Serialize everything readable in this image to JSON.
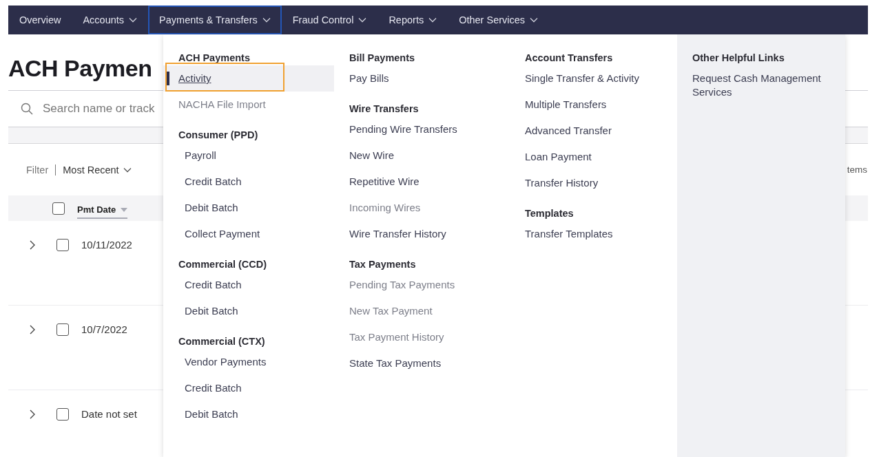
{
  "nav": [
    {
      "label": "Overview",
      "dropdown": false,
      "selected": false
    },
    {
      "label": "Accounts",
      "dropdown": true,
      "selected": false
    },
    {
      "label": "Payments & Transfers",
      "dropdown": true,
      "selected": true
    },
    {
      "label": "Fraud Control",
      "dropdown": true,
      "selected": false
    },
    {
      "label": "Reports",
      "dropdown": true,
      "selected": false
    },
    {
      "label": "Other Services",
      "dropdown": true,
      "selected": false
    }
  ],
  "page": {
    "title": "ACH Paymen",
    "search": {
      "placeholder": "Search name or track"
    },
    "filter": {
      "label": "Filter",
      "sort": "Most Recent",
      "right_text": "tems"
    },
    "table": {
      "all_checked": false,
      "columns": [
        {
          "label": "Pmt Date",
          "sorted": true
        }
      ],
      "rows": [
        {
          "date": "10/11/2022",
          "checked": false,
          "expanded": false
        },
        {
          "date": "10/7/2022",
          "checked": false,
          "expanded": false
        },
        {
          "date": "Date not set",
          "checked": false,
          "expanded": false
        }
      ]
    }
  },
  "menu": {
    "columns": [
      {
        "shaded": false,
        "sections": [
          {
            "heading": "ACH Payments",
            "items": [
              {
                "label": "Activity",
                "selected": true,
                "annotated": true,
                "disabled": false,
                "indented": false
              },
              {
                "label": "NACHA File Import",
                "selected": false,
                "annotated": false,
                "disabled": true,
                "indented": false
              }
            ]
          },
          {
            "heading": "Consumer (PPD)",
            "items": [
              {
                "label": "Payroll",
                "selected": false,
                "annotated": false,
                "disabled": false,
                "indented": true
              },
              {
                "label": "Credit Batch",
                "selected": false,
                "annotated": false,
                "disabled": false,
                "indented": true
              },
              {
                "label": "Debit Batch",
                "selected": false,
                "annotated": false,
                "disabled": false,
                "indented": true
              },
              {
                "label": "Collect Payment",
                "selected": false,
                "annotated": false,
                "disabled": false,
                "indented": true
              }
            ]
          },
          {
            "heading": "Commercial (CCD)",
            "items": [
              {
                "label": "Credit Batch",
                "selected": false,
                "annotated": false,
                "disabled": false,
                "indented": true
              },
              {
                "label": "Debit Batch",
                "selected": false,
                "annotated": false,
                "disabled": false,
                "indented": true
              }
            ]
          },
          {
            "heading": "Commercial (CTX)",
            "items": [
              {
                "label": "Vendor Payments",
                "selected": false,
                "annotated": false,
                "disabled": false,
                "indented": true
              },
              {
                "label": "Credit Batch",
                "selected": false,
                "annotated": false,
                "disabled": false,
                "indented": true
              },
              {
                "label": "Debit Batch",
                "selected": false,
                "annotated": false,
                "disabled": false,
                "indented": true
              }
            ]
          }
        ]
      },
      {
        "shaded": false,
        "sections": [
          {
            "heading": "Bill Payments",
            "items": [
              {
                "label": "Pay Bills",
                "selected": false,
                "annotated": false,
                "disabled": false,
                "indented": false
              }
            ]
          },
          {
            "heading": "Wire Transfers",
            "items": [
              {
                "label": "Pending Wire Transfers",
                "selected": false,
                "annotated": false,
                "disabled": false,
                "indented": false
              },
              {
                "label": "New Wire",
                "selected": false,
                "annotated": false,
                "disabled": false,
                "indented": false
              },
              {
                "label": "Repetitive Wire",
                "selected": false,
                "annotated": false,
                "disabled": false,
                "indented": false
              },
              {
                "label": "Incoming Wires",
                "selected": false,
                "annotated": false,
                "disabled": true,
                "indented": false
              },
              {
                "label": "Wire Transfer History",
                "selected": false,
                "annotated": false,
                "disabled": false,
                "indented": false
              }
            ]
          },
          {
            "heading": "Tax Payments",
            "items": [
              {
                "label": "Pending Tax Payments",
                "selected": false,
                "annotated": false,
                "disabled": true,
                "indented": false
              },
              {
                "label": "New Tax Payment",
                "selected": false,
                "annotated": false,
                "disabled": true,
                "indented": false
              },
              {
                "label": "Tax Payment History",
                "selected": false,
                "annotated": false,
                "disabled": true,
                "indented": false
              },
              {
                "label": "State Tax Payments",
                "selected": false,
                "annotated": false,
                "disabled": false,
                "indented": false
              }
            ]
          }
        ]
      },
      {
        "shaded": false,
        "sections": [
          {
            "heading": "Account Transfers",
            "items": [
              {
                "label": "Single Transfer & Activity",
                "selected": false,
                "annotated": false,
                "disabled": false,
                "indented": false
              },
              {
                "label": "Multiple Transfers",
                "selected": false,
                "annotated": false,
                "disabled": false,
                "indented": false
              },
              {
                "label": "Advanced Transfer",
                "selected": false,
                "annotated": false,
                "disabled": false,
                "indented": false
              },
              {
                "label": "Loan Payment",
                "selected": false,
                "annotated": false,
                "disabled": false,
                "indented": false
              },
              {
                "label": "Transfer History",
                "selected": false,
                "annotated": false,
                "disabled": false,
                "indented": false
              }
            ]
          },
          {
            "heading": "Templates",
            "items": [
              {
                "label": "Transfer Templates",
                "selected": false,
                "annotated": false,
                "disabled": false,
                "indented": false
              }
            ]
          }
        ]
      },
      {
        "shaded": true,
        "sections": [
          {
            "heading": "Other Helpful Links",
            "items": [
              {
                "label": "Request Cash Management Services",
                "selected": false,
                "annotated": false,
                "disabled": false,
                "indented": false
              }
            ]
          }
        ]
      }
    ]
  }
}
